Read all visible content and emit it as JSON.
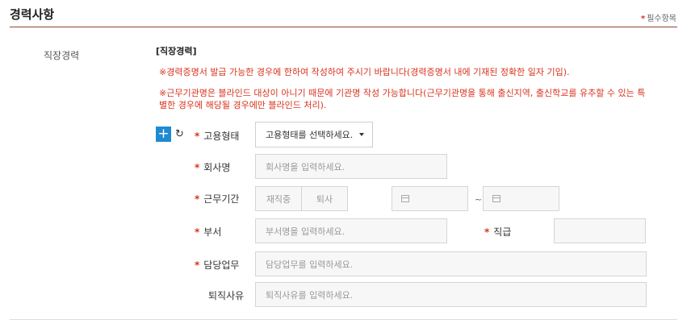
{
  "section": {
    "title": "경력사항",
    "required_note": "필수항목",
    "required_star": "*"
  },
  "career": {
    "row_label": "직장경력",
    "sub_heading": "[직장경력]",
    "notice1": "※경력증명서 발급 가능한 경우에 한하여 작성하여 주시기 바랍니다(경력증명서 내에 기재된 정확한 일자 기입).",
    "notice2": "※근무기관명은 블라인드 대상이 아니기 때문에 기관명 작성 가능합니다(근무기관명을 통해 출신지역, 출신학교를 유추할 수 있는 특별한 경우에 해당될 경우에만 블라인드 처리).",
    "add_icon": "+",
    "reset_icon": "↻"
  },
  "fields": {
    "employment_type": {
      "label": "고용형태",
      "selected": "고용형태를 선택하세요."
    },
    "company": {
      "label": "회사명",
      "placeholder": "회사명을 입력하세요."
    },
    "period": {
      "label": "근무기간",
      "employed": "재직중",
      "resigned": "퇴사",
      "tilde": "~"
    },
    "department": {
      "label": "부서",
      "placeholder": "부서명을 입력하세요."
    },
    "position": {
      "label": "직급"
    },
    "duties": {
      "label": "담당업무",
      "placeholder": "담당업무를 입력하세요."
    },
    "leave_reason": {
      "label": "퇴직사유",
      "placeholder": "퇴직사유를 입력하세요."
    }
  },
  "colors": {
    "accent": "#d8321d",
    "button": "#1f8ad1",
    "rule": "#8f4a35"
  }
}
